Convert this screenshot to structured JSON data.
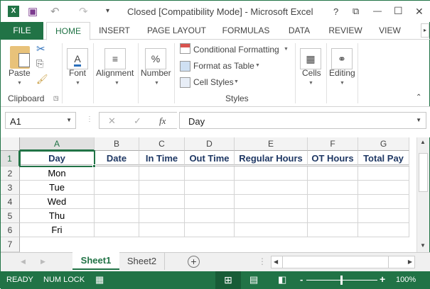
{
  "window": {
    "title": "Closed  [Compatibility Mode] - Microsoft Excel",
    "help": "?",
    "restore": "⧉",
    "minimize": "—",
    "maximize": "☐",
    "close": "✕"
  },
  "tabs": [
    "FILE",
    "HOME",
    "INSERT",
    "PAGE LAYOUT",
    "FORMULAS",
    "DATA",
    "REVIEW",
    "VIEW"
  ],
  "ribbon": {
    "paste": "Paste",
    "clipboard": "Clipboard",
    "font": "Font",
    "alignment": "Alignment",
    "number": "Number",
    "conditional_formatting": "Conditional Formatting",
    "format_as_table": "Format as Table",
    "cell_styles": "Cell Styles",
    "styles": "Styles",
    "cells": "Cells",
    "editing": "Editing"
  },
  "formula_bar": {
    "name_box": "A1",
    "fx": "fx",
    "cancel": "✕",
    "enter": "✓",
    "value": "Day"
  },
  "columns": [
    "A",
    "B",
    "C",
    "D",
    "E",
    "F",
    "G"
  ],
  "rows": [
    "1",
    "2",
    "3",
    "4",
    "5",
    "6",
    "7"
  ],
  "cells": [
    [
      "Day",
      "Date",
      "In Time",
      "Out Time",
      "Regular Hours",
      "OT Hours",
      "Total Pay"
    ],
    [
      "Mon",
      "",
      "",
      "",
      "",
      "",
      ""
    ],
    [
      "Tue",
      "",
      "",
      "",
      "",
      "",
      ""
    ],
    [
      "Wed",
      "",
      "",
      "",
      "",
      "",
      ""
    ],
    [
      "Thu",
      "",
      "",
      "",
      "",
      "",
      ""
    ],
    [
      "Fri",
      "",
      "",
      "",
      "",
      "",
      ""
    ]
  ],
  "sheets": [
    "Sheet1",
    "Sheet2"
  ],
  "active_sheet": "Sheet1",
  "status": {
    "ready": "READY",
    "numlock": "NUM LOCK",
    "zoom": "100%",
    "zoom_minus": "-",
    "zoom_plus": "+"
  },
  "colors": {
    "accent": "#217346",
    "header_text": "#1f3864"
  }
}
